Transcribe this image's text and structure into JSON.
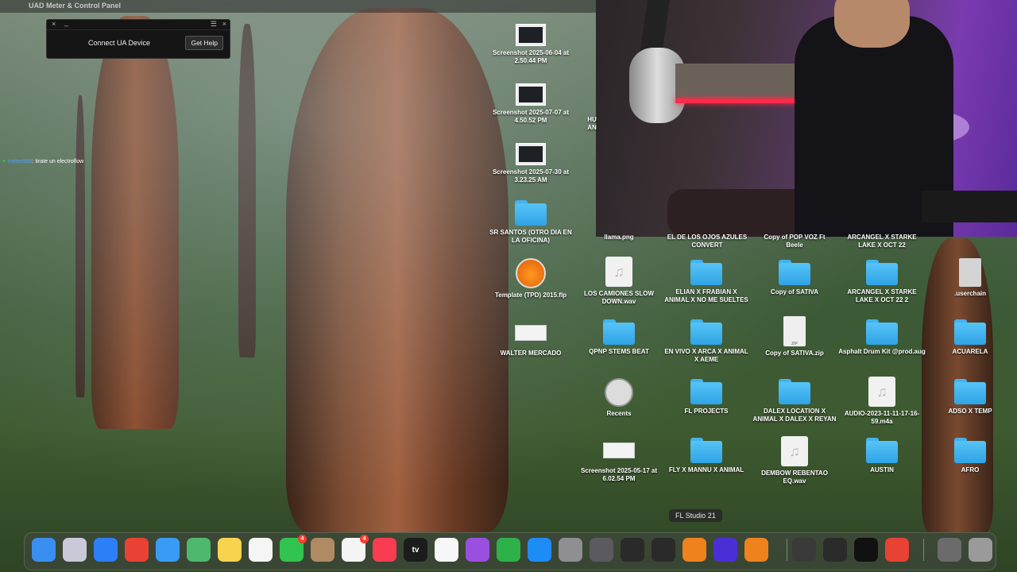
{
  "menubar": {
    "app_title": "UAD Meter & Control Panel"
  },
  "uad_panel": {
    "connect_label": "Connect UA Device",
    "help_button": "Get Help"
  },
  "chat": {
    "user": "mxteo999",
    "message": ": tirate un electroflow"
  },
  "desktop": {
    "items": [
      {
        "label": "Screenshot 2025-06-04 at 2.50.44 PM"
      },
      {
        "label": "Screenshot 2025-07-07 at 4.50.52 PM"
      },
      {
        "label": "Screenshot 2025-07-30 at 3.23.25 AM"
      },
      {
        "label": "SR SANTOS (OTRO DIA EN LA OFICINA)"
      },
      {
        "label": "Template (TPD) 2015.flp"
      },
      {
        "label": "WALTER MERCADO"
      },
      {
        "label": "LOS CAMIONES SLOW DOWN.wav"
      },
      {
        "label": "QPNP STEMS BEAT"
      },
      {
        "label": "Recents"
      },
      {
        "label": "Screenshot 2025-05-17 at 6.02.54 PM"
      },
      {
        "label": "ELIAN X FRABIAN X ANIMAL X NO ME SUELTES"
      },
      {
        "label": "EN VIVO X ARCA X ANIMAL X AEME"
      },
      {
        "label": "FL PROJECTS"
      },
      {
        "label": "FLY X MANNU X ANIMAL"
      },
      {
        "label": "Copy of SATIVA"
      },
      {
        "label": "Copy of SATIVA.zip"
      },
      {
        "label": "DALEX LOCATION X ANIMAL X DALEX X REYAN"
      },
      {
        "label": "DEMBOW REBENTAO EQ.wav"
      },
      {
        "label": "ARCANGEL X STARKE LAKE X OCT 22 2"
      },
      {
        "label": "Asphalt Drum Kit @prod.aug"
      },
      {
        "label": "AUDIO-2023-11-11-17-16-59.m4a"
      },
      {
        "label": "AUSTIN"
      },
      {
        "label": ".userchain"
      },
      {
        "label": "ACUARELA"
      },
      {
        "label": "ADSO X TEMP"
      },
      {
        "label": "AFRO"
      }
    ],
    "partial_labels": {
      "llama": "llama.png",
      "convert": "EL DE LOS OJOS AZULES CONVERT",
      "beele": "Copy of POP VOZ Ft Beele",
      "arcangel_top": "ARCANGEL X STARKE LAKE X OCT 22",
      "hu": "HU AN"
    }
  },
  "tooltip": "FL Studio 21",
  "dock": {
    "apps": [
      {
        "name": "finder-icon",
        "color": "#3a8ef0",
        "badge": ""
      },
      {
        "name": "launchpad-icon",
        "color": "#c9c9d9",
        "badge": ""
      },
      {
        "name": "safari-icon",
        "color": "#2d7ff9",
        "badge": ""
      },
      {
        "name": "chrome-icon",
        "color": "#e94235",
        "badge": ""
      },
      {
        "name": "mail-icon",
        "color": "#3a9bf7",
        "badge": ""
      },
      {
        "name": "maps-icon",
        "color": "#4fb86f",
        "badge": ""
      },
      {
        "name": "notes-icon",
        "color": "#f7d34e",
        "badge": ""
      },
      {
        "name": "freeform-icon",
        "color": "#f5f5f5",
        "badge": ""
      },
      {
        "name": "facetime-icon",
        "color": "#31c450",
        "badge": "4"
      },
      {
        "name": "contacts-icon",
        "color": "#b08a63",
        "badge": ""
      },
      {
        "name": "reminders-icon",
        "color": "#f4f4f4",
        "badge": "4"
      },
      {
        "name": "music-icon",
        "color": "#fa3c52",
        "badge": ""
      },
      {
        "name": "tv-icon",
        "color": "#1c1c1c",
        "badge": ""
      },
      {
        "name": "news-icon",
        "color": "#f7f7f7",
        "badge": ""
      },
      {
        "name": "podcasts-icon",
        "color": "#9b4fe0",
        "badge": ""
      },
      {
        "name": "numbers-icon",
        "color": "#2fb14a",
        "badge": ""
      },
      {
        "name": "app-store-icon",
        "color": "#1d8cf5",
        "badge": ""
      },
      {
        "name": "system-settings-icon",
        "color": "#8e8e93",
        "badge": ""
      },
      {
        "name": "iphone-mirroring-icon",
        "color": "#5a5a60",
        "badge": ""
      },
      {
        "name": "uad-meter-icon",
        "color": "#2a2a2a",
        "badge": ""
      },
      {
        "name": "uad-console-icon",
        "color": "#2a2a2a",
        "badge": ""
      },
      {
        "name": "fl-studio-icon",
        "color": "#f0821e",
        "badge": ""
      },
      {
        "name": "arc-icon",
        "color": "#4b2fd6",
        "badge": ""
      },
      {
        "name": "fl-studio-2-icon",
        "color": "#f0821e",
        "badge": ""
      },
      {
        "name": "apogee-icon",
        "color": "#3a3a3a",
        "badge": ""
      },
      {
        "name": "obs-icon",
        "color": "#2b2b2b",
        "badge": ""
      },
      {
        "name": "capcut-icon",
        "color": "#111111",
        "badge": ""
      },
      {
        "name": "chrome-2-icon",
        "color": "#e94235",
        "badge": ""
      },
      {
        "name": "downloads-icon",
        "color": "#6b6b6b",
        "badge": ""
      },
      {
        "name": "trash-icon",
        "color": "#9a9a9a",
        "badge": ""
      }
    ],
    "tv_label": "tv"
  }
}
